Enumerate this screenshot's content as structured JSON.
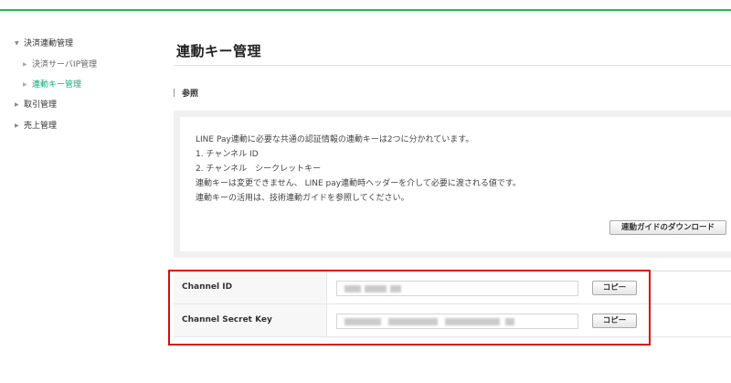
{
  "sidebar": {
    "items": [
      {
        "label": "決済連動管理"
      },
      {
        "label": "決済サーバIP管理"
      },
      {
        "label": "連動キー管理"
      },
      {
        "label": "取引管理"
      },
      {
        "label": "売上管理"
      }
    ]
  },
  "main": {
    "title": "連動キー管理",
    "section_title": "参照",
    "info_lines": [
      "LINE Pay連動に必要な共通の認証情報の連動キーは2つに分かれています。",
      "1. チャンネル ID",
      "2. チャンネル　シークレットキー",
      "連動キーは変更できません、 LINE pay連動時ヘッダーを介して必要に渡される値です。",
      "連動キーの活用は、技術連動ガイドを参照してください。"
    ],
    "download_button": "連動ガイドのダウンロード"
  },
  "credentials": [
    {
      "label": "Channel ID",
      "copy_label": "コピー"
    },
    {
      "label": "Channel Secret Key",
      "copy_label": "コピー"
    }
  ],
  "colors": {
    "accent_green": "#33b34a",
    "active_nav": "#1aaa7a",
    "highlight_red": "#d80c0c"
  }
}
